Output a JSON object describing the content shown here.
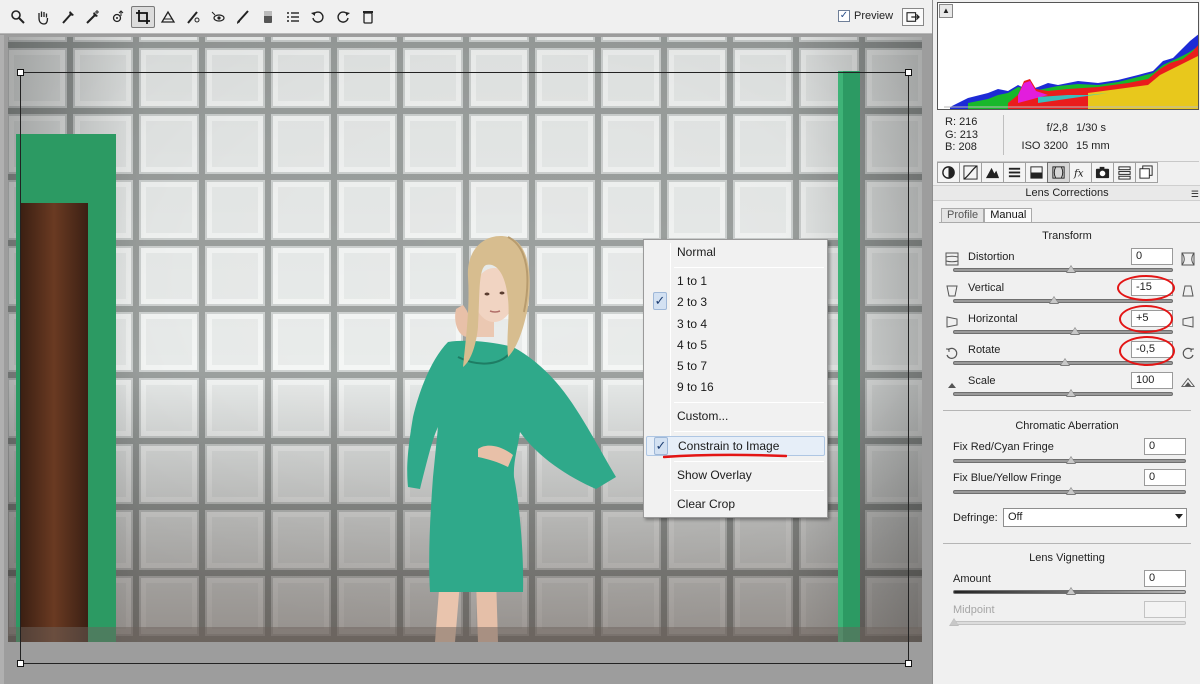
{
  "toolbar": {
    "tools": [
      "zoom-icon",
      "hand-icon",
      "white-balance-icon",
      "color-sampler-icon",
      "target-adjustment-icon",
      "crop-icon",
      "straighten-icon",
      "spot-removal-icon",
      "red-eye-icon",
      "adjustment-brush-icon",
      "graduated-filter-icon",
      "preferences-icon",
      "rotate-ccw-icon",
      "rotate-cw-icon",
      "trash-icon"
    ],
    "preview_label": "Preview",
    "preview_checked": true
  },
  "crop_menu": {
    "items": {
      "normal": "Normal",
      "r1_1": "1 to 1",
      "r2_3": "2 to 3",
      "r3_4": "3 to 4",
      "r4_5": "4 to 5",
      "r5_7": "5 to 7",
      "r9_16": "9 to 16",
      "custom": "Custom...",
      "constrain": "Constrain to Image",
      "overlay": "Show Overlay",
      "clear": "Clear Crop"
    },
    "check_mark": "✓"
  },
  "readout": {
    "r_label": "R:",
    "r_value": "216",
    "g_label": "G:",
    "g_value": "213",
    "b_label": "B:",
    "b_value": "208",
    "aperture": "f/2,8",
    "shutter": "1/30 s",
    "iso": "ISO 3200",
    "focal": "15 mm"
  },
  "panel": {
    "title": "Lens Corrections",
    "tabs": [
      "basic-icon",
      "tone-curve-icon",
      "detail-icon",
      "hsl-icon",
      "split-toning-icon",
      "lens-corrections-icon",
      "effects-icon",
      "camera-calibration-icon",
      "presets-icon",
      "snapshots-icon"
    ],
    "subtabs": {
      "profile": "Profile",
      "manual": "Manual"
    }
  },
  "transform": {
    "title": "Transform",
    "distortion_label": "Distortion",
    "distortion_value": "0",
    "vertical_label": "Vertical",
    "vertical_value": "-15",
    "horizontal_label": "Horizontal",
    "horizontal_value": "+5",
    "rotate_label": "Rotate",
    "rotate_value": "-0,5",
    "scale_label": "Scale",
    "scale_value": "100"
  },
  "chromatic": {
    "title": "Chromatic Aberration",
    "red_cyan_label": "Fix Red/Cyan Fringe",
    "red_cyan_value": "0",
    "blue_yellow_label": "Fix Blue/Yellow Fringe",
    "blue_yellow_value": "0",
    "defringe_label": "Defringe:",
    "defringe_value": "Off"
  },
  "vignetting": {
    "title": "Lens Vignetting",
    "amount_label": "Amount",
    "amount_value": "0",
    "midpoint_label": "Midpoint",
    "midpoint_value": ""
  },
  "colors": {
    "accent_red": "#e31515",
    "dress": "#2fa98a",
    "door_frame": "#2c9a63"
  }
}
